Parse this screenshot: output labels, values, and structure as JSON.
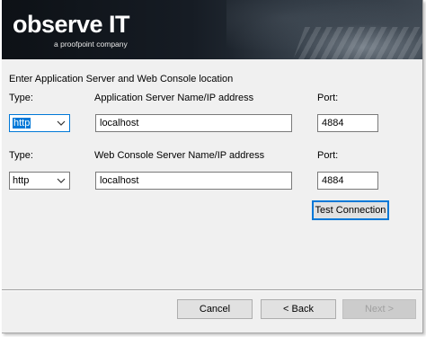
{
  "branding": {
    "logo_text": "observe IT",
    "logo_subtext": "a proofpoint company"
  },
  "form": {
    "heading": "Enter Application Server and Web Console location",
    "app_server": {
      "type_label": "Type:",
      "type_value": "http",
      "name_label": "Application Server Name/IP address",
      "name_value": "localhost",
      "port_label": "Port:",
      "port_value": "4884"
    },
    "web_console": {
      "type_label": "Type:",
      "type_value": "http",
      "name_label": "Web Console Server Name/IP address",
      "name_value": "localhost",
      "port_label": "Port:",
      "port_value": "4884"
    },
    "test_connection_label": "Test Connection"
  },
  "footer": {
    "cancel_label": "Cancel",
    "back_label": "< Back",
    "next_label": "Next >"
  },
  "icons": {
    "dropdown": "chevron-down-icon"
  }
}
